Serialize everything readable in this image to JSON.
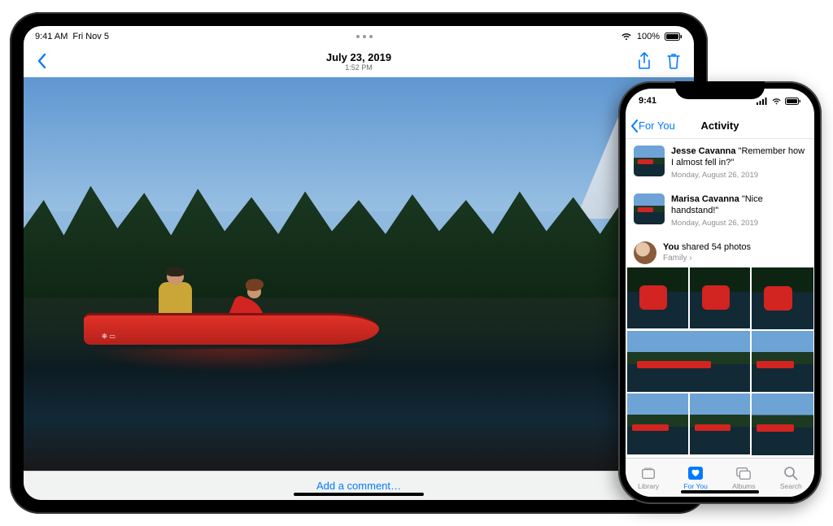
{
  "ipad": {
    "status": {
      "time": "9:41 AM",
      "date": "Fri Nov 5",
      "battery": "100%"
    },
    "nav": {
      "title": "July 23, 2019",
      "subtitle": "1:52 PM"
    },
    "comment_placeholder": "Add a comment…"
  },
  "iphone": {
    "status": {
      "time": "9:41"
    },
    "nav": {
      "back_label": "For You",
      "title": "Activity"
    },
    "activity": [
      {
        "author": "Jesse Cavanna",
        "quote": "\"Remember how I almost fell in?\"",
        "date": "Monday, August 26, 2019"
      },
      {
        "author": "Marisa Cavanna",
        "quote": "\"Nice handstand!\"",
        "date": "Monday, August 26, 2019"
      }
    ],
    "shared": {
      "prefix": "You",
      "text": " shared 54 photos",
      "album": "Family"
    },
    "tabs": [
      {
        "label": "Library"
      },
      {
        "label": "For You"
      },
      {
        "label": "Albums"
      },
      {
        "label": "Search"
      }
    ]
  }
}
